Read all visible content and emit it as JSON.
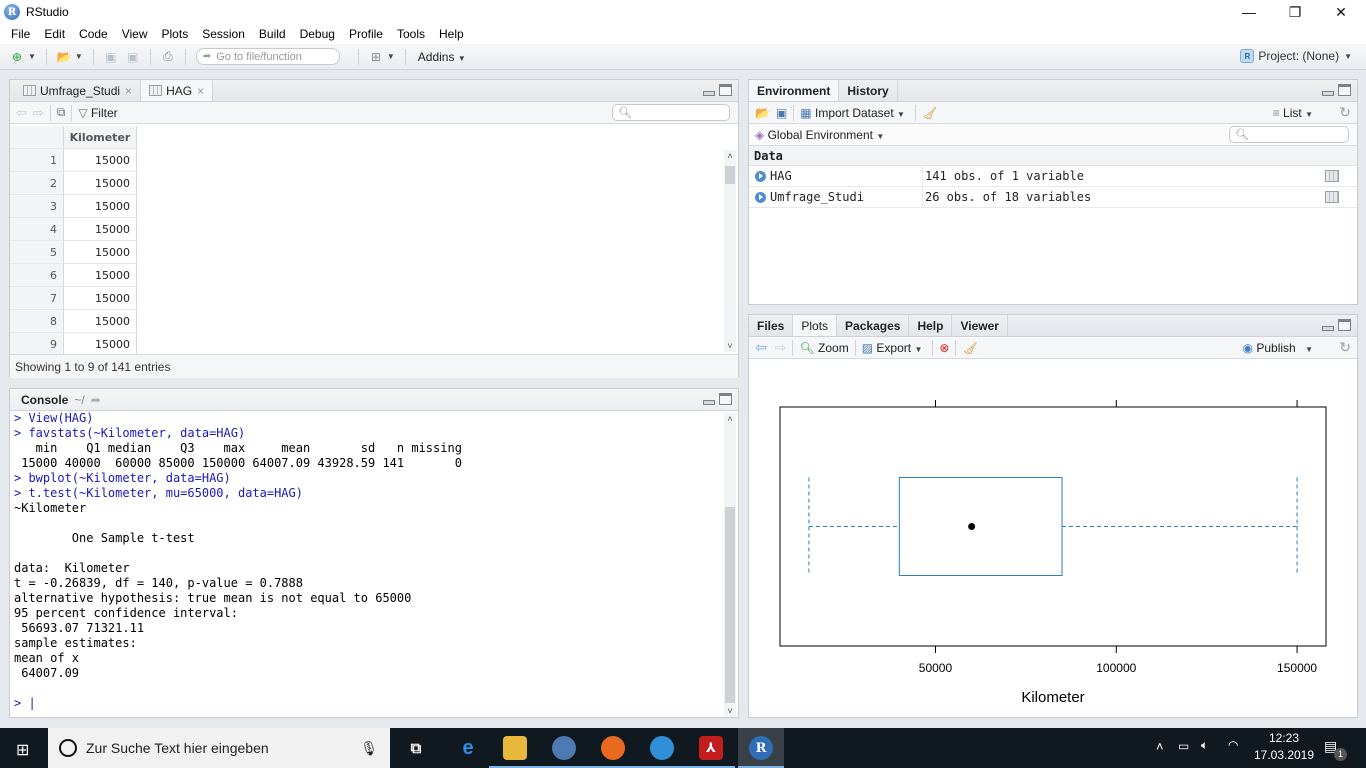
{
  "window": {
    "title": "RStudio",
    "controls": {
      "minimize": "—",
      "restore": "❐",
      "close": "✕"
    }
  },
  "menu": [
    "File",
    "Edit",
    "Code",
    "View",
    "Plots",
    "Session",
    "Build",
    "Debug",
    "Profile",
    "Tools",
    "Help"
  ],
  "toolbar": {
    "goto_placeholder": "Go to file/function",
    "addins_label": "Addins",
    "project_label": "Project: (None)"
  },
  "source_pane": {
    "tabs": [
      {
        "label": "Umfrage_Studi",
        "close": "×",
        "active": false
      },
      {
        "label": "HAG",
        "close": "×",
        "active": true
      }
    ],
    "filter_label": "Filter",
    "search_placeholder": "",
    "column_header": "Kilometer",
    "rows": [
      {
        "index": "1",
        "value": "15000"
      },
      {
        "index": "2",
        "value": "15000"
      },
      {
        "index": "3",
        "value": "15000"
      },
      {
        "index": "4",
        "value": "15000"
      },
      {
        "index": "5",
        "value": "15000"
      },
      {
        "index": "6",
        "value": "15000"
      },
      {
        "index": "7",
        "value": "15000"
      },
      {
        "index": "8",
        "value": "15000"
      },
      {
        "index": "9",
        "value": "15000"
      }
    ],
    "footer": "Showing 1 to 9 of 141 entries"
  },
  "console": {
    "title": "Console",
    "path": "~/",
    "lines": [
      {
        "type": "cmd",
        "text": "> View(HAG)"
      },
      {
        "type": "cmd",
        "text": "> favstats(~Kilometer, data=HAG)"
      },
      {
        "type": "out",
        "text": "   min    Q1 median    Q3    max     mean       sd   n missing"
      },
      {
        "type": "out",
        "text": " 15000 40000  60000 85000 150000 64007.09 43928.59 141       0"
      },
      {
        "type": "cmd",
        "text": "> bwplot(~Kilometer, data=HAG)"
      },
      {
        "type": "cmd",
        "text": "> t.test(~Kilometer, mu=65000, data=HAG)"
      },
      {
        "type": "out",
        "text": "~Kilometer"
      },
      {
        "type": "out",
        "text": ""
      },
      {
        "type": "out",
        "text": "        One Sample t-test"
      },
      {
        "type": "out",
        "text": ""
      },
      {
        "type": "out",
        "text": "data:  Kilometer"
      },
      {
        "type": "out",
        "text": "t = -0.26839, df = 140, p-value = 0.7888"
      },
      {
        "type": "out",
        "text": "alternative hypothesis: true mean is not equal to 65000"
      },
      {
        "type": "out",
        "text": "95 percent confidence interval:"
      },
      {
        "type": "out",
        "text": " 56693.07 71321.11"
      },
      {
        "type": "out",
        "text": "sample estimates:"
      },
      {
        "type": "out",
        "text": "mean of x "
      },
      {
        "type": "out",
        "text": " 64007.09 "
      },
      {
        "type": "out",
        "text": ""
      },
      {
        "type": "cmd",
        "text": "> |"
      }
    ]
  },
  "environment_pane": {
    "tabs": [
      {
        "label": "Environment",
        "active": true
      },
      {
        "label": "History",
        "active": false
      }
    ],
    "import_label": "Import Dataset",
    "list_label": "List",
    "scope_label": "Global Environment",
    "section": "Data",
    "items": [
      {
        "name": "HAG",
        "desc": "141 obs. of 1 variable"
      },
      {
        "name": "Umfrage_Studi",
        "desc": "26 obs. of 18 variables"
      }
    ]
  },
  "files_pane": {
    "tabs": [
      {
        "label": "Files",
        "active": false
      },
      {
        "label": "Plots",
        "active": true
      },
      {
        "label": "Packages",
        "active": false
      },
      {
        "label": "Help",
        "active": false
      },
      {
        "label": "Viewer",
        "active": false
      }
    ],
    "zoom_label": "Zoom",
    "export_label": "Export",
    "publish_label": "Publish"
  },
  "chart_data": {
    "type": "box",
    "title": "",
    "xlabel": "Kilometer",
    "ylabel": "",
    "xlim": [
      7000,
      158000
    ],
    "ticks": [
      50000,
      100000,
      150000
    ],
    "tick_labels": [
      "50000",
      "100000",
      "150000"
    ],
    "box": {
      "min": 15000,
      "q1": 40000,
      "median": 60000,
      "q3": 85000,
      "max": 150000
    },
    "color": "#0080ff",
    "grid": false
  },
  "taskbar": {
    "search_placeholder": "Zur Suche Text hier eingeben",
    "time": "12:23",
    "date": "17.03.2019",
    "notifications": "1"
  },
  "colors": {
    "console_cmd": "#1a1ab8",
    "box_stroke": "#2e7dc2",
    "taskbar_bg": "#101820"
  }
}
